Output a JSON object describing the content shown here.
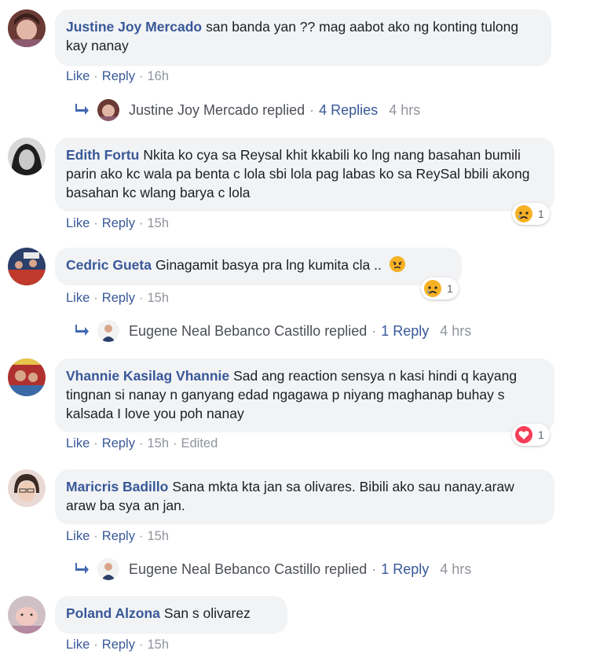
{
  "labels": {
    "like": "Like",
    "reply": "Reply",
    "edited": "Edited"
  },
  "comments": [
    {
      "author": "Justine Joy Mercado",
      "text": "san banda yan ?? mag aabot ako ng konting tulong kay nanay",
      "time": "16h",
      "reply": {
        "name": "Justine Joy Mercado",
        "replied": "replied",
        "count": "4 Replies",
        "ago": "4 hrs"
      }
    },
    {
      "author": "Edith Fortu",
      "text": "Nkita ko cya sa Reysal khit kkabili ko lng nang basahan bumili parin ako kc wala pa benta c lola sbi lola pag labas ko sa ReySal bbili akong basahan kc wlang barya c lola",
      "time": "15h",
      "reaction": {
        "icon": "sad-reaction-icon",
        "count": "1"
      }
    },
    {
      "author": "Cedric Gueta",
      "text": "Ginagamit basya pra lng kumita cla ..",
      "time": "15h",
      "reaction": {
        "icon": "sad-reaction-icon",
        "count": "1"
      },
      "reply": {
        "name": "Eugene Neal Bebanco Castillo",
        "replied": "replied",
        "count": "1 Reply",
        "ago": "4 hrs"
      }
    },
    {
      "author": "Vhannie Kasilag Vhannie",
      "text": "Sad ang reaction sensya n kasi hindi q kayang tingnan si nanay n ganyang edad ngagawa p niyang maghanap buhay s kalsada I love you poh nanay",
      "time": "15h",
      "reaction": {
        "icon": "love-reaction-icon",
        "count": "1"
      }
    },
    {
      "author": "Maricris Badillo",
      "text": "Sana mkta kta jan sa olivares. Bibili ako sau nanay.araw araw ba sya an jan.",
      "time": "15h",
      "reply": {
        "name": "Eugene Neal Bebanco Castillo",
        "replied": "replied",
        "count": "1 Reply",
        "ago": "4 hrs"
      }
    },
    {
      "author": "Poland Alzona",
      "text": "San s olivarez",
      "time": "15h"
    }
  ],
  "colors": {
    "link": "#385898",
    "meta": "#90949c",
    "bubble": "#f2f3f5"
  }
}
